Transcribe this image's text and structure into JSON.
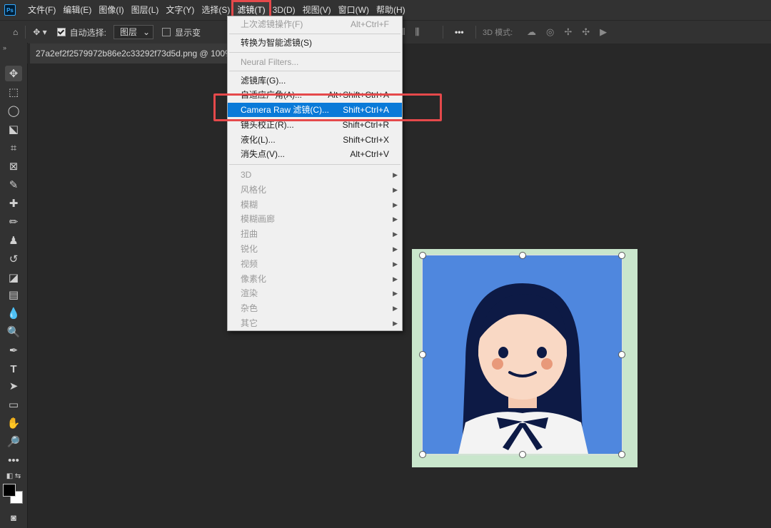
{
  "app": {
    "logo": "Ps"
  },
  "menubar": {
    "items": [
      "文件(F)",
      "编辑(E)",
      "图像(I)",
      "图层(L)",
      "文字(Y)",
      "选择(S)",
      "滤镜(T)",
      "3D(D)",
      "视图(V)",
      "窗口(W)",
      "帮助(H)"
    ],
    "active": "滤镜(T)"
  },
  "options": {
    "auto_select_label": "自动选择:",
    "auto_select_value": "图层",
    "show_transform_label": "显示变",
    "threed_mode_label": "3D 模式:"
  },
  "document": {
    "tab_title": "27a2ef2f2579972b86e2c33292f73d5d.png @ 100%("
  },
  "filter_menu": {
    "last_filter": {
      "label": "上次滤镜操作(F)",
      "shortcut": "Alt+Ctrl+F"
    },
    "smart": {
      "label": "转换为智能滤镜(S)"
    },
    "neural": {
      "label": "Neural Filters..."
    },
    "gallery": {
      "label": "滤镜库(G)..."
    },
    "adaptive": {
      "label": "自适应广角(A)...",
      "shortcut": "Alt+Shift+Ctrl+A"
    },
    "camera_raw": {
      "label": "Camera Raw 滤镜(C)...",
      "shortcut": "Shift+Ctrl+A"
    },
    "lens": {
      "label": "镜头校正(R)...",
      "shortcut": "Shift+Ctrl+R"
    },
    "liquify": {
      "label": "液化(L)...",
      "shortcut": "Shift+Ctrl+X"
    },
    "vanish": {
      "label": "消失点(V)...",
      "shortcut": "Alt+Ctrl+V"
    },
    "submenus": [
      "3D",
      "风格化",
      "模糊",
      "模糊画廊",
      "扭曲",
      "锐化",
      "视频",
      "像素化",
      "渲染",
      "杂色",
      "其它"
    ]
  },
  "colors": {
    "accent": "#0a7ad8",
    "highlight_box": "#e5494b",
    "photo_bg": "#4f87de",
    "frame": "#c9e6cc"
  }
}
